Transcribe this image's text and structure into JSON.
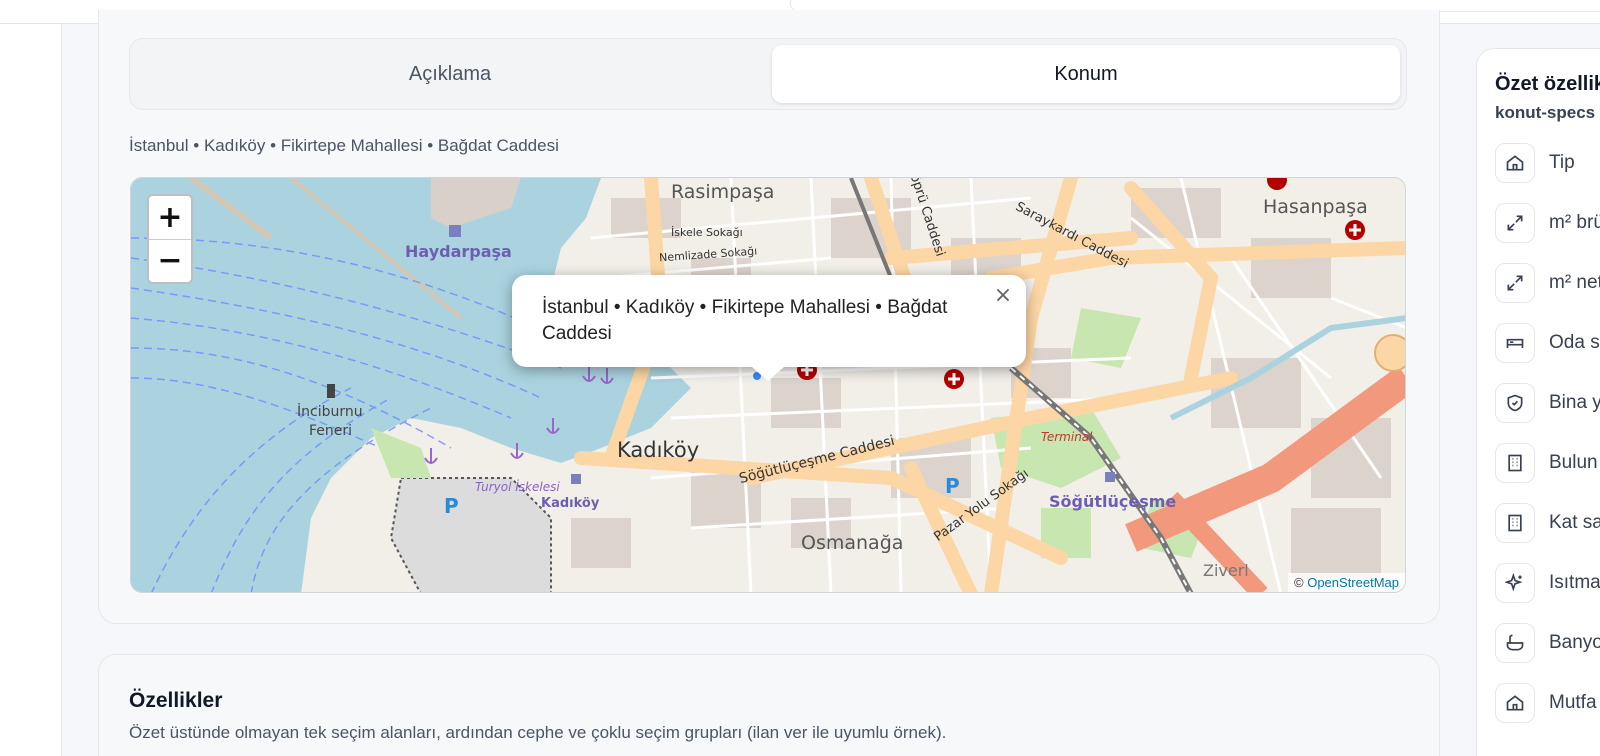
{
  "tabs": [
    {
      "label": "Açıklama",
      "active": false
    },
    {
      "label": "Konum",
      "active": true
    }
  ],
  "location": {
    "address": "İstanbul • Kadıköy • Fikirtepe Mahallesi • Bağdat Caddesi",
    "popup_text": "İstanbul • Kadıköy • Fikirtepe Mahallesi • Bağdat Caddesi",
    "zoom_in": "+",
    "zoom_out": "−",
    "close_glyph": "×",
    "attribution_prefix": "©",
    "attribution_link": "OpenStreetMap"
  },
  "map_labels": {
    "rasimpasa": "Rasimpaşa",
    "haydarpasa": "Haydarpaşa",
    "hasanpasa": "Hasanpaşa",
    "kadikoy": "Kadıköy",
    "inciburnu_1": "İnciburnu",
    "inciburnu_2": "Feneri",
    "sogutlucesme_caddesi": "Söğütlüçeşme Caddesi",
    "sogutlucesme": "Söğütlüçeşme",
    "osmanaga": "Osmanağa",
    "pazar_yolu": "Pazar Yolu Sokağı",
    "sarayardi": "Saraykardı Caddesi",
    "iskele_sokagi": "İskele Sokağı",
    "nemlizade": "Nemlizade Sokağı",
    "terminal": "Terminal",
    "kadikoy_small": "Kadıköy",
    "turyol": "Turyol İskelesi",
    "ziverl": "Ziverl",
    "kopru": "Köprü Caddesi",
    "parking": "P"
  },
  "features": {
    "title": "Özellikler",
    "description": "Özet üstünde olmayan tek seçim alanları, ardından cephe ve çoklu seçim grupları (ilan ver ile uyumlu örnek)."
  },
  "summary": {
    "title": "Özet özellik",
    "subtitle": "konut-specs",
    "specs": [
      {
        "icon": "home-icon",
        "label": "Tip"
      },
      {
        "icon": "expand-icon",
        "label": "m² brü"
      },
      {
        "icon": "expand-icon",
        "label": "m² net"
      },
      {
        "icon": "bed-icon",
        "label": "Oda s"
      },
      {
        "icon": "shield-icon",
        "label": "Bina y"
      },
      {
        "icon": "building-icon",
        "label": "Bulun"
      },
      {
        "icon": "building-icon",
        "label": "Kat sa"
      },
      {
        "icon": "sparkles-icon",
        "label": "Isıtma"
      },
      {
        "icon": "bath-icon",
        "label": "Banyo"
      },
      {
        "icon": "home-icon",
        "label": "Mutfa"
      }
    ]
  },
  "colors": {
    "sea": "#aad3df",
    "land": "#f2efe9",
    "road_major": "#fcd6a4",
    "road_highway": "#f2997d",
    "park": "#c8e6b0"
  }
}
